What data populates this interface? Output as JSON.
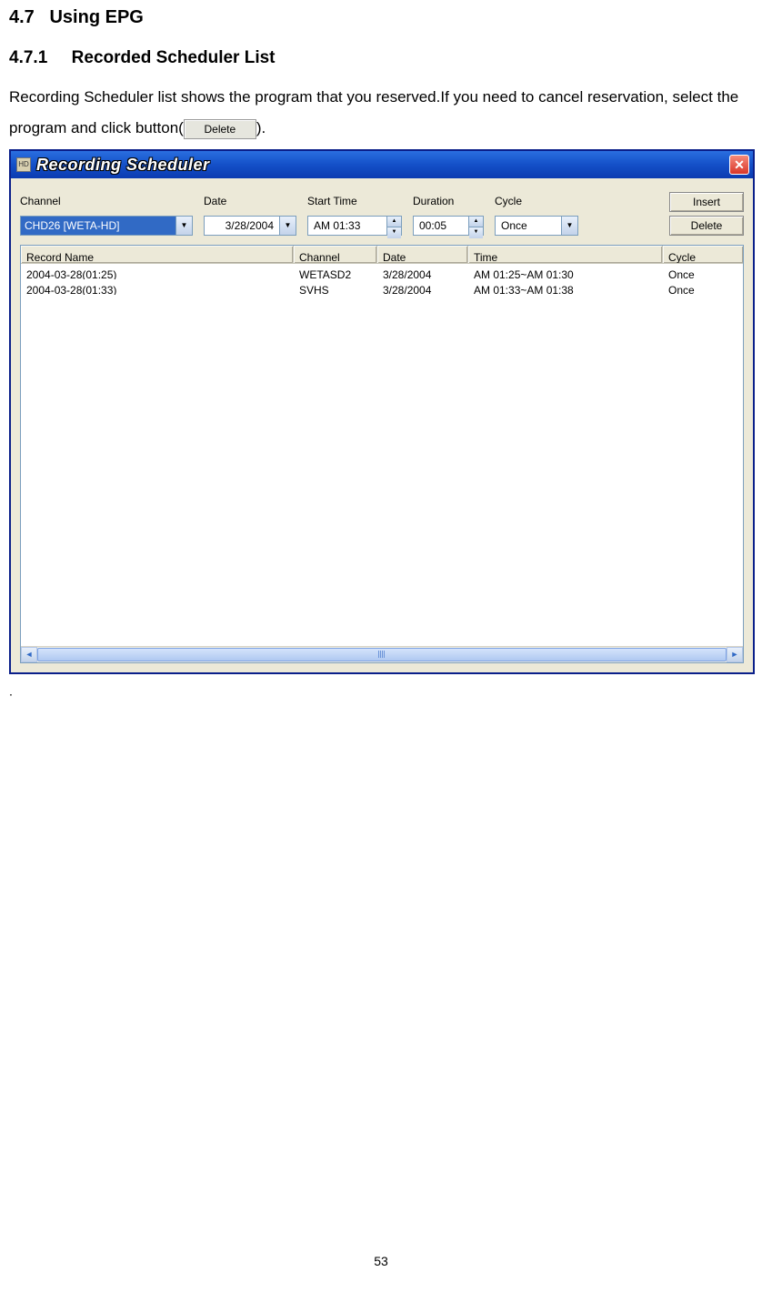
{
  "doc": {
    "section_number": "4.7",
    "section_title": "Using EPG",
    "subsection_number": "4.7.1",
    "subsection_title": "Recorded Scheduler List",
    "para_before": "Recording Scheduler list shows the program that you reserved.If you need to cancel reservation, select the program and click button(",
    "para_after": ").",
    "inline_delete_label": "Delete",
    "page_number": "53"
  },
  "window": {
    "title": "Recording Scheduler",
    "icon_text": "HD"
  },
  "controls": {
    "channel_label": "Channel",
    "channel_value": "CHD26 [WETA-HD]",
    "date_label": "Date",
    "date_value": "3/28/2004",
    "start_label": "Start Time",
    "start_value": "AM 01:33",
    "duration_label": "Duration",
    "duration_value": "00:05",
    "cycle_label": "Cycle",
    "cycle_value": "Once",
    "insert_btn": "Insert",
    "delete_btn": "Delete"
  },
  "table": {
    "headers": {
      "name": "Record Name",
      "channel": "Channel",
      "date": "Date",
      "time": "Time",
      "cycle": "Cycle"
    },
    "rows": [
      {
        "name": "2004-03-28(01:25)",
        "channel": "WETASD2",
        "date": "3/28/2004",
        "time": "AM 01:25~AM 01:30",
        "cycle": "Once"
      },
      {
        "name": "2004-03-28(01:33)",
        "channel": "SVHS",
        "date": "3/28/2004",
        "time": "AM 01:33~AM 01:38",
        "cycle": "Once"
      }
    ]
  }
}
